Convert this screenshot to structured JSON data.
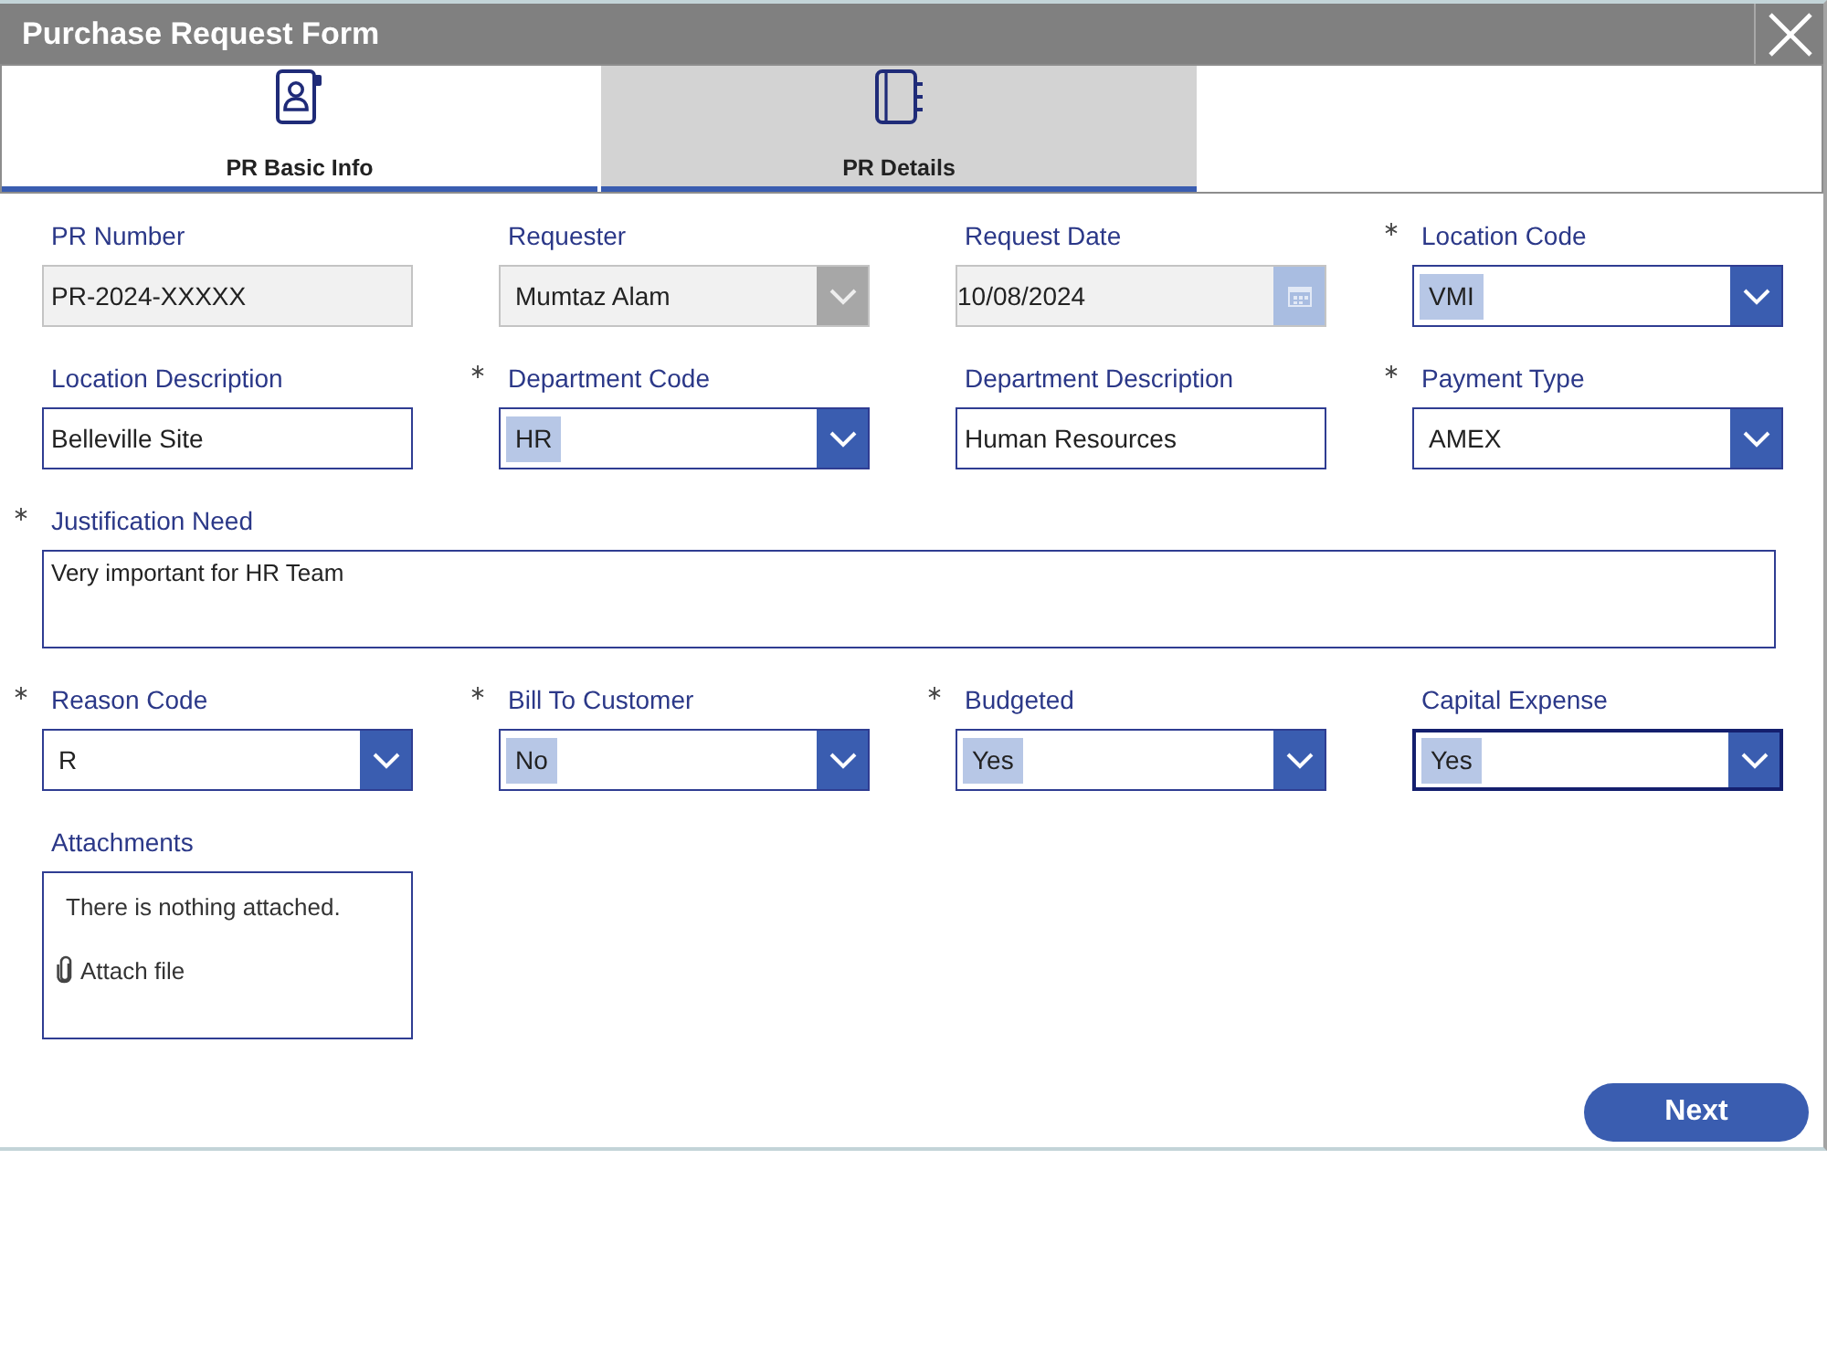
{
  "window": {
    "title": "Purchase Request Form"
  },
  "tabs": [
    {
      "label": "PR Basic Info",
      "selected": false
    },
    {
      "label": "PR Details",
      "selected": true
    }
  ],
  "fields": [
    {
      "label": "PR Number",
      "required": false,
      "kind": "text",
      "value": "PR-2024-XXXXX",
      "disabled": true,
      "focused": false
    },
    {
      "label": "Requester",
      "required": false,
      "kind": "dropdown",
      "value": "Mumtaz Alam",
      "disabled": true,
      "focused": false
    },
    {
      "label": "Request Date",
      "required": false,
      "kind": "date",
      "value": "10/08/2024",
      "disabled": true,
      "focused": false
    },
    {
      "label": "Location Code",
      "required": true,
      "kind": "combobox",
      "value": "VMI",
      "disabled": false,
      "focused": false
    },
    {
      "label": "Location Description",
      "required": false,
      "kind": "text",
      "value": "Belleville Site",
      "disabled": false,
      "focused": false
    },
    {
      "label": "Department Code",
      "required": true,
      "kind": "combobox",
      "value": "HR",
      "disabled": false,
      "focused": false
    },
    {
      "label": "Department Description",
      "required": false,
      "kind": "text",
      "value": "Human Resources",
      "disabled": false,
      "focused": false
    },
    {
      "label": "Payment Type",
      "required": true,
      "kind": "dropdown",
      "value": "AMEX",
      "disabled": false,
      "focused": false
    },
    {
      "label": "Justification Need",
      "required": true,
      "kind": "textarea",
      "value": "Very important for HR Team",
      "disabled": false,
      "focused": false
    },
    {
      "label": "Reason Code",
      "required": true,
      "kind": "dropdown",
      "value": "R",
      "disabled": false,
      "focused": false
    },
    {
      "label": "Bill To Customer",
      "required": true,
      "kind": "combobox",
      "value": "No",
      "disabled": false,
      "focused": false
    },
    {
      "label": "Budgeted",
      "required": true,
      "kind": "combobox",
      "value": "Yes",
      "disabled": false,
      "focused": false
    },
    {
      "label": "Capital Expense",
      "required": false,
      "kind": "combobox",
      "value": "Yes",
      "disabled": false,
      "focused": true
    },
    {
      "label": "Attachments",
      "required": false,
      "kind": "attachments",
      "message": "There is nothing attached.",
      "action": "Attach file",
      "disabled": false,
      "focused": false
    }
  ],
  "next_button": {
    "label": "Next"
  }
}
